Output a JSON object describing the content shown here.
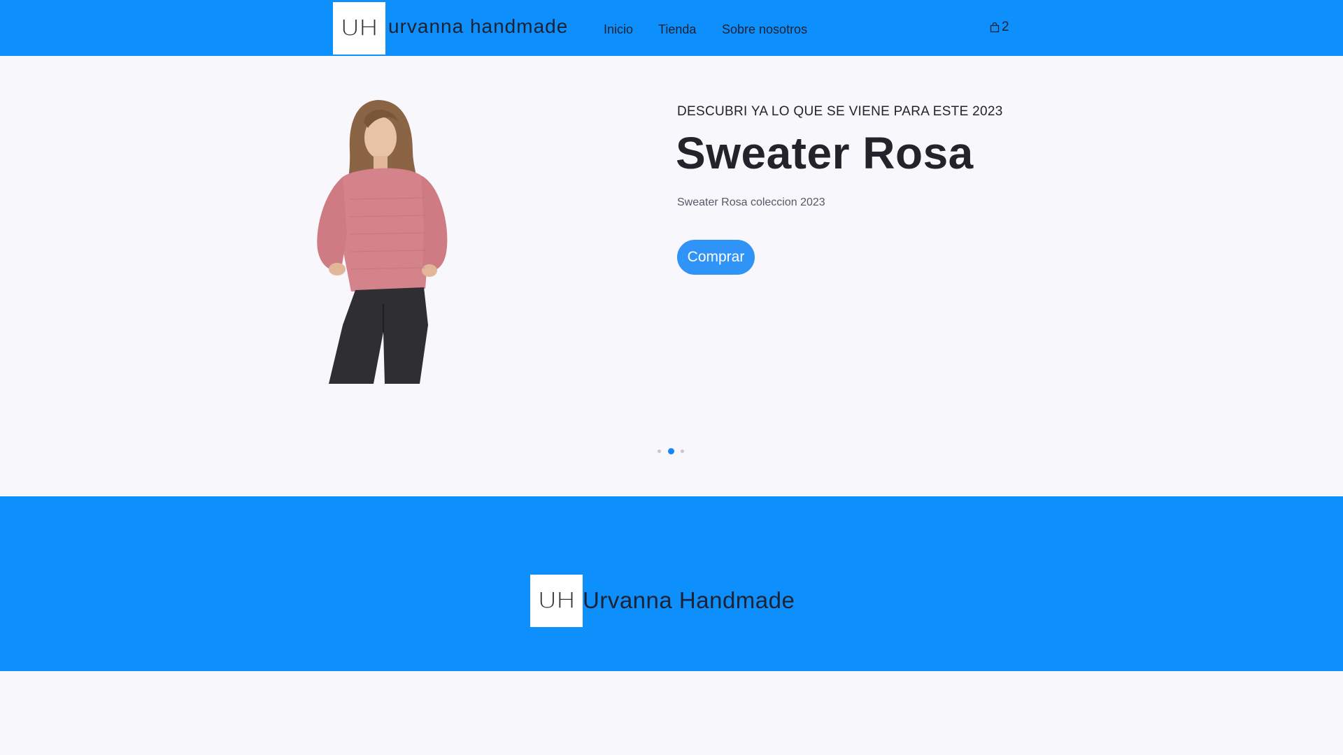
{
  "header": {
    "logo_mark": "UH",
    "brand": "urvanna handmade",
    "nav": {
      "inicio": "Inicio",
      "tienda": "Tienda",
      "sobre": "Sobre nosotros"
    },
    "cart_count": "2",
    "cart_icon": "shopping-bag-icon",
    "background_color": "#0d8ffc"
  },
  "hero": {
    "eyebrow": "DESCUBRI YA LO QUE SE VIENE PARA ESTE 2023",
    "title": "Sweater Rosa",
    "description": "Sweater Rosa coleccion 2023",
    "button_label": "Comprar",
    "button_color": "#2f93f8",
    "carousel": {
      "slide_count": 3,
      "active_index": 1,
      "active_color": "#1688f5"
    }
  },
  "footer": {
    "logo_mark": "UH",
    "brand": "Urvanna Handmade",
    "background_color": "#0d8ffc"
  }
}
